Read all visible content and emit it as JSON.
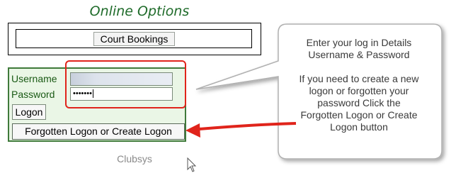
{
  "header": {
    "title": "Online Options"
  },
  "court": {
    "button_label": "Court Bookings"
  },
  "login": {
    "username_label": "Username",
    "password_label": "Password",
    "password_value": "•••••••",
    "logon_label": "Logon",
    "forgot_label": "Forgotten Logon or Create Logon"
  },
  "footer": {
    "text": "Clubsys"
  },
  "callout": {
    "line1": "Enter your log in Details",
    "line2": "Username & Password",
    "line3": "If you need to create a new",
    "line4": "logon or forgotten your",
    "line5": "password Click the",
    "line6": "Forgotten Logon or Create",
    "line7": "Logon button"
  },
  "colors": {
    "title_green": "#1f6b2a",
    "panel_bg": "#eaf6e6",
    "panel_border": "#3f7a3a",
    "annotation_red": "#e0241b"
  }
}
